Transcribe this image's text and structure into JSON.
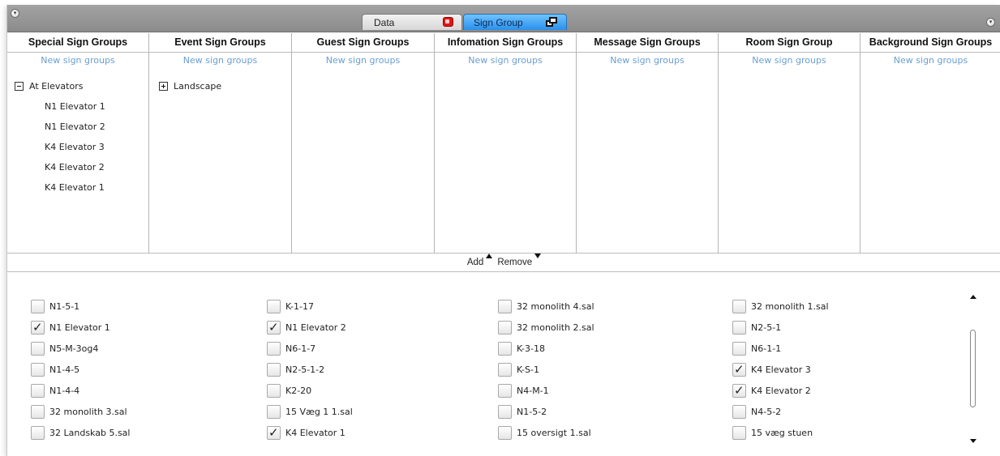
{
  "tabs": [
    {
      "label": "Data",
      "icon": "close-icon",
      "active": false
    },
    {
      "label": "Sign Group",
      "icon": "popout-icon",
      "active": true
    }
  ],
  "columns": [
    {
      "header": "Special Sign Groups",
      "new_link": "New sign groups",
      "tree": [
        {
          "label": "At Elevators",
          "expanded": true,
          "children": [
            "N1 Elevator 1",
            "N1 Elevator 2",
            "K4 Elevator 3",
            "K4 Elevator 2",
            "K4 Elevator 1"
          ]
        }
      ]
    },
    {
      "header": "Event Sign Groups",
      "new_link": "New sign groups",
      "tree": [
        {
          "label": "Landscape",
          "expanded": false,
          "children": []
        }
      ]
    },
    {
      "header": "Guest Sign Groups",
      "new_link": "New sign groups",
      "tree": []
    },
    {
      "header": "Infomation Sign Groups",
      "new_link": "New sign groups",
      "tree": []
    },
    {
      "header": "Message Sign Groups",
      "new_link": "New sign groups",
      "tree": []
    },
    {
      "header": "Room Sign Group",
      "new_link": "New sign groups",
      "tree": []
    },
    {
      "header": "Background Sign Groups",
      "new_link": "New sign groups",
      "tree": []
    }
  ],
  "actions": {
    "add_label": "Add",
    "remove_label": "Remove"
  },
  "sign_columns": [
    [
      {
        "label": "N1-5-1",
        "checked": false
      },
      {
        "label": "N1 Elevator 1",
        "checked": true
      },
      {
        "label": "N5-M-3og4",
        "checked": false
      },
      {
        "label": "N1-4-5",
        "checked": false
      },
      {
        "label": "N1-4-4",
        "checked": false
      },
      {
        "label": "32 monolith 3.sal",
        "checked": false
      },
      {
        "label": "32 Landskab 5.sal",
        "checked": false
      }
    ],
    [
      {
        "label": "K-1-17",
        "checked": false
      },
      {
        "label": "N1 Elevator 2",
        "checked": true
      },
      {
        "label": "N6-1-7",
        "checked": false
      },
      {
        "label": "N2-5-1-2",
        "checked": false
      },
      {
        "label": "K2-20",
        "checked": false
      },
      {
        "label": "15 Væg 1 1.sal",
        "checked": false
      },
      {
        "label": "K4 Elevator 1",
        "checked": true
      }
    ],
    [
      {
        "label": "32 monolith 4.sal",
        "checked": false
      },
      {
        "label": "32 monolith 2.sal",
        "checked": false
      },
      {
        "label": "K-3-18",
        "checked": false
      },
      {
        "label": "K-S-1",
        "checked": false
      },
      {
        "label": "N4-M-1",
        "checked": false
      },
      {
        "label": "N1-5-2",
        "checked": false
      },
      {
        "label": "15 oversigt 1.sal",
        "checked": false
      }
    ],
    [
      {
        "label": "32 monolith 1.sal",
        "checked": false
      },
      {
        "label": "N2-5-1",
        "checked": false
      },
      {
        "label": "N6-1-1",
        "checked": false
      },
      {
        "label": "K4 Elevator 3",
        "checked": true
      },
      {
        "label": "K4 Elevator 2",
        "checked": true
      },
      {
        "label": "N4-5-2",
        "checked": false
      },
      {
        "label": "15 væg stuen",
        "checked": false
      }
    ]
  ],
  "colors": {
    "accent_tab": "#2a90ea",
    "link": "#6a9ed0",
    "close_red": "#e01616"
  }
}
